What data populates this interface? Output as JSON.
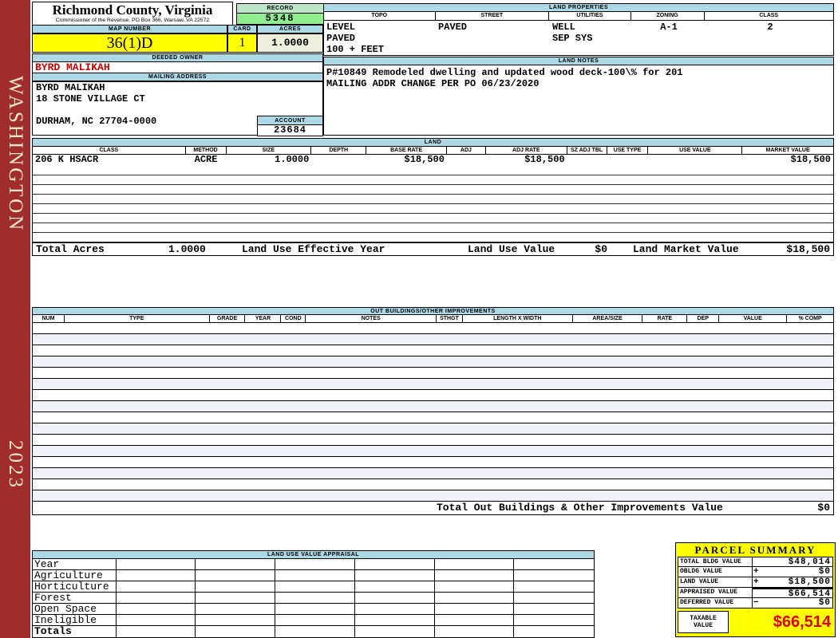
{
  "sidebar": {
    "county": "WASHINGTON",
    "year": "2023"
  },
  "header": {
    "county_title": "Richmond County, Virginia",
    "subtitle": "Commissioner of the Revenue, PO Box 366, Warsaw, VA 22572",
    "record_label": "RECORD",
    "record_value": "5348",
    "map_number_label": "MAP NUMBER",
    "map_number_value": "36(1)D",
    "card_label": "CARD",
    "card_value": "1",
    "acres_label": "ACRES",
    "acres_value": "1.0000"
  },
  "owner": {
    "deeded_owner_label": "DEEDED OWNER",
    "deeded_owner": "BYRD MALIKAH",
    "mailing_label": "MAILING ADDRESS",
    "mailing_lines": [
      "BYRD MALIKAH",
      "18 STONE VILLAGE CT",
      "",
      "DURHAM, NC 27704-0000"
    ],
    "account_label": "ACCOUNT",
    "account_value": "23684"
  },
  "land_properties": {
    "title": "LAND PROPERTIES",
    "columns": [
      "TOPO",
      "STREET",
      "UTILITIES",
      "ZONING",
      "CLASS"
    ],
    "values": {
      "topo": [
        "LEVEL",
        "PAVED",
        "100 + FEET"
      ],
      "street": [
        "PAVED"
      ],
      "utilities": [
        "WELL",
        "SEP SYS"
      ],
      "zoning": [
        "A-1"
      ],
      "class": [
        "2"
      ]
    }
  },
  "land_notes": {
    "title": "LAND NOTES",
    "lines": [
      "P#10849 Remodeled dwelling and updated wood deck-100\\% for 201",
      "MAILING ADDR CHANGE PER PO 06/23/2020"
    ]
  },
  "land_table": {
    "title": "LAND",
    "columns": [
      "CLASS",
      "METHOD",
      "SIZE",
      "DEPTH",
      "BASE RATE",
      "ADJ",
      "ADJ RATE",
      "SZ ADJ TBL",
      "USE TYPE",
      "USE VALUE",
      "MARKET VALUE"
    ],
    "rows": [
      [
        "206 K HSACR",
        "ACRE",
        "1.0000",
        "",
        "$18,500",
        "",
        "$18,500",
        "",
        "",
        "",
        "$18,500"
      ]
    ],
    "empty_row_count": 8,
    "totals": {
      "total_acres_label": "Total Acres",
      "total_acres_value": "1.0000",
      "effective_year_label": "Land Use Effective Year",
      "land_use_value_label": "Land Use Value",
      "land_use_value": "$0",
      "land_market_value_label": "Land Market Value",
      "land_market_value": "$18,500"
    }
  },
  "out_buildings": {
    "title": "OUT BUILDINGS/OTHER IMPROVEMENTS",
    "columns": [
      "NUM",
      "TYPE",
      "GRADE",
      "YEAR",
      "COND",
      "NOTES",
      "STHGT",
      "LENGTH X WIDTH",
      "AREA/SIZE",
      "RATE",
      "DEP",
      "VALUE",
      "% COMP"
    ],
    "empty_row_count": 16,
    "total_label": "Total Out Buildings & Other Improvements Value",
    "total_value": "$0"
  },
  "land_use_appraisal": {
    "title": "LAND USE VALUE APPRAISAL",
    "row_labels": [
      "Year",
      "Agriculture",
      "Horticulture",
      "Forest",
      "Open Space",
      "Ineligible",
      "Totals"
    ],
    "data_column_count": 6
  },
  "parcel_summary": {
    "title": "PARCEL SUMMARY",
    "rows": [
      {
        "label": "TOTAL BLDG VALUE",
        "operator": "",
        "value": "$48,014"
      },
      {
        "label": "OBLDG VALUE",
        "operator": "+",
        "value": "$0"
      },
      {
        "label": "LAND VALUE",
        "operator": "+",
        "value": "$18,500"
      },
      {
        "label": "APPRAISED VALUE",
        "operator": "",
        "value": "$66,514"
      },
      {
        "label": "DEFERRED VALUE",
        "operator": "−",
        "value": "$0"
      }
    ],
    "taxable_label": "TAXABLE VALUE",
    "taxable_value": "$66,514"
  },
  "colors": {
    "header_blue": "#ADD8E6",
    "record_green": "#90EE90",
    "highlight_yellow": "#FFFF00",
    "acres_beige": "#EFEFDE",
    "sidebar_red": "#A02C2C",
    "owner_text_red": "#CC0000",
    "taxable_text_red": "#DD0000"
  }
}
